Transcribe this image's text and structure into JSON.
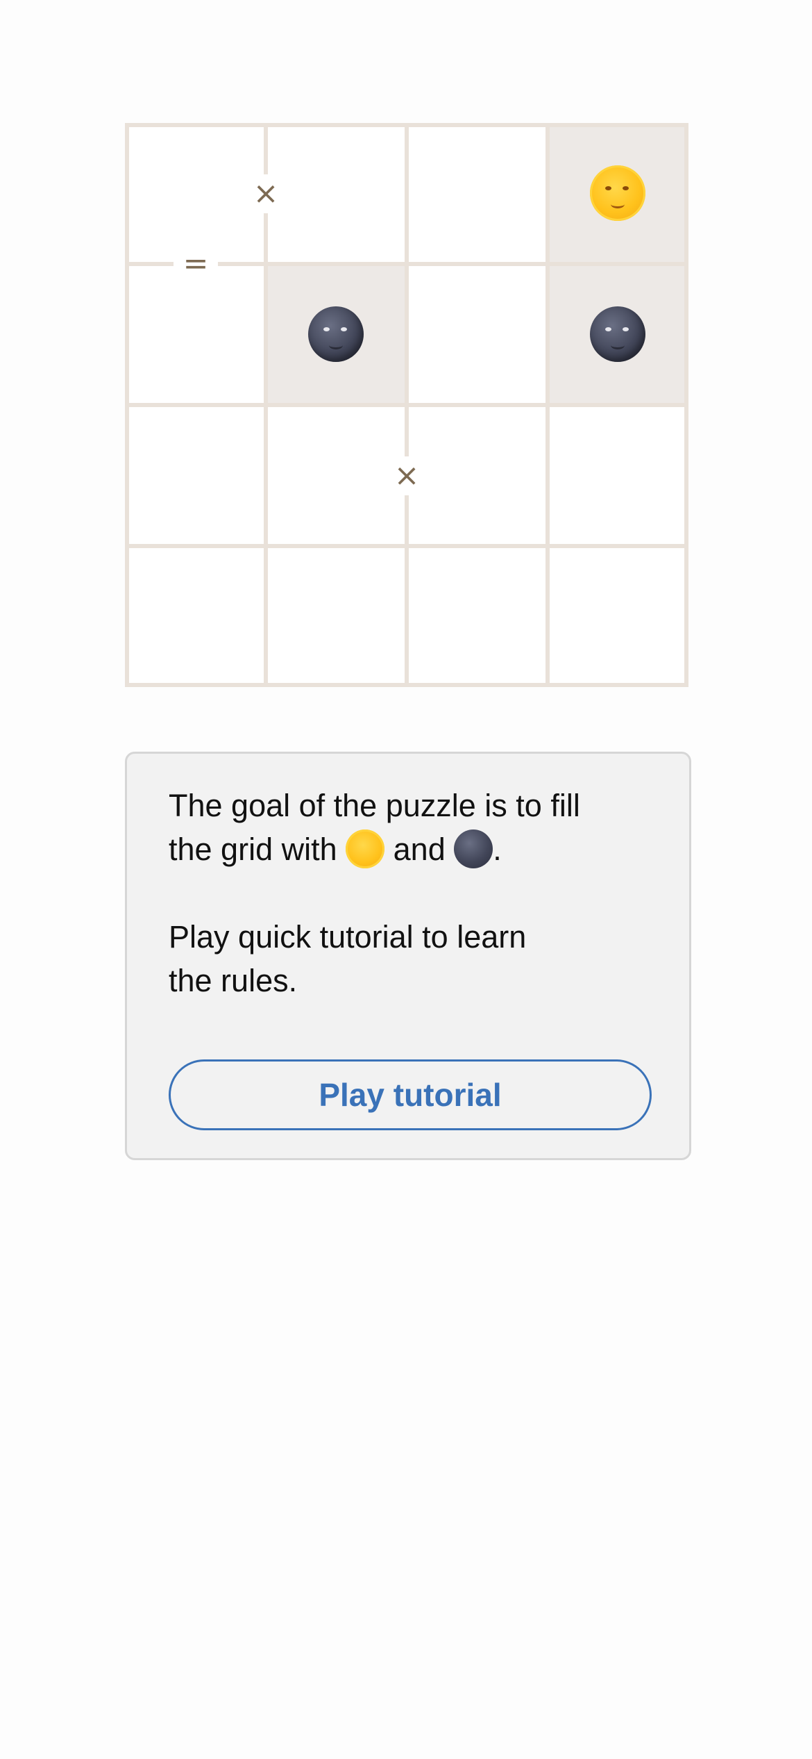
{
  "grid": {
    "rows": 4,
    "cols": 4,
    "cells": [
      [
        "",
        "",
        "",
        "sun"
      ],
      [
        "",
        "moon",
        "",
        "moon"
      ],
      [
        "",
        "",
        "",
        ""
      ],
      [
        "",
        "",
        "",
        ""
      ]
    ],
    "locked": [
      [
        false,
        false,
        false,
        true
      ],
      [
        false,
        true,
        false,
        true
      ],
      [
        false,
        false,
        false,
        false
      ],
      [
        false,
        false,
        false,
        false
      ]
    ],
    "constraints": [
      {
        "symbol": "×",
        "between": [
          [
            0,
            0
          ],
          [
            0,
            1
          ]
        ]
      },
      {
        "symbol": "=",
        "between": [
          [
            0,
            0
          ],
          [
            1,
            0
          ]
        ]
      },
      {
        "symbol": "×",
        "between": [
          [
            2,
            1
          ],
          [
            2,
            2
          ]
        ]
      }
    ]
  },
  "info": {
    "goal_line1": "The goal of the puzzle is to fill",
    "goal_line2_prefix": "the grid with",
    "goal_line2_and": "and",
    "goal_line2_suffix": ".",
    "hint_line1": "Play quick tutorial to learn",
    "hint_line2": "the rules.",
    "button_label": "Play tutorial"
  },
  "icons": {
    "sun": "sun-with-face-icon",
    "moon": "new-moon-face-icon"
  },
  "colors": {
    "grid_line": "#e9e1d9",
    "locked_cell": "#ede9e6",
    "constraint": "#7d6a52",
    "accent": "#3a72b8",
    "card_bg": "#f2f2f2"
  }
}
